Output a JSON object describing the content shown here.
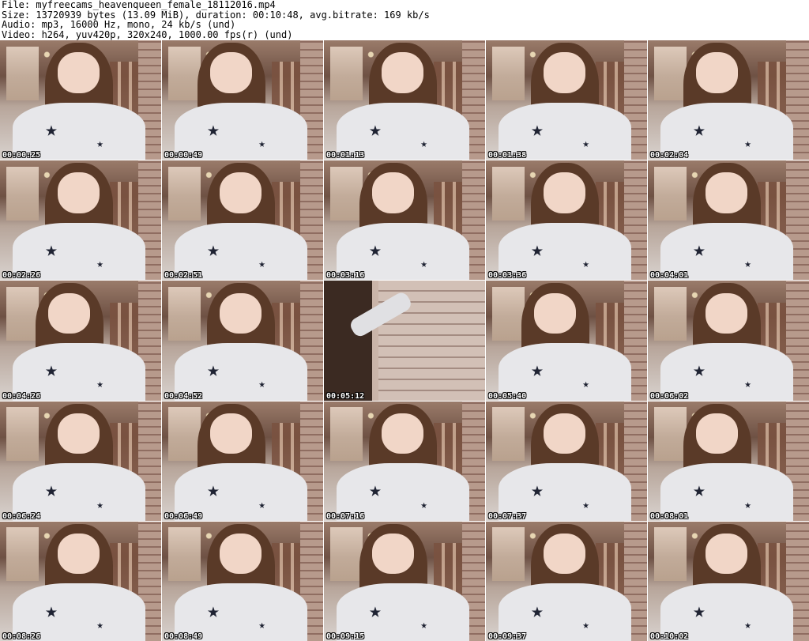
{
  "header": {
    "line1": "File: myfreecams_heavenqueen_female_18112016.mp4",
    "line2": "Size: 13720939 bytes (13.09 MiB), duration: 00:10:48, avg.bitrate: 169 kb/s",
    "line3": "Audio: mp3, 16000 Hz, mono, 24 kb/s (und)",
    "line4": "Video: h264, yuv420p, 320x240, 1000.00 fps(r) (und)"
  },
  "thumbnails": [
    {
      "time": "00:00:25"
    },
    {
      "time": "00:00:49"
    },
    {
      "time": "00:01:13"
    },
    {
      "time": "00:01:38"
    },
    {
      "time": "00:02:04"
    },
    {
      "time": "00:02:26"
    },
    {
      "time": "00:02:51"
    },
    {
      "time": "00:03:16"
    },
    {
      "time": "00:03:36"
    },
    {
      "time": "00:04:01"
    },
    {
      "time": "00:04:26"
    },
    {
      "time": "00:04:52"
    },
    {
      "time": "00:05:12"
    },
    {
      "time": "00:05:40"
    },
    {
      "time": "00:06:02"
    },
    {
      "time": "00:06:24"
    },
    {
      "time": "00:06:49"
    },
    {
      "time": "00:07:16"
    },
    {
      "time": "00:07:37"
    },
    {
      "time": "00:08:01"
    },
    {
      "time": "00:08:26"
    },
    {
      "time": "00:08:49"
    },
    {
      "time": "00:09:15"
    },
    {
      "time": "00:09:37"
    },
    {
      "time": "00:10:02"
    }
  ]
}
